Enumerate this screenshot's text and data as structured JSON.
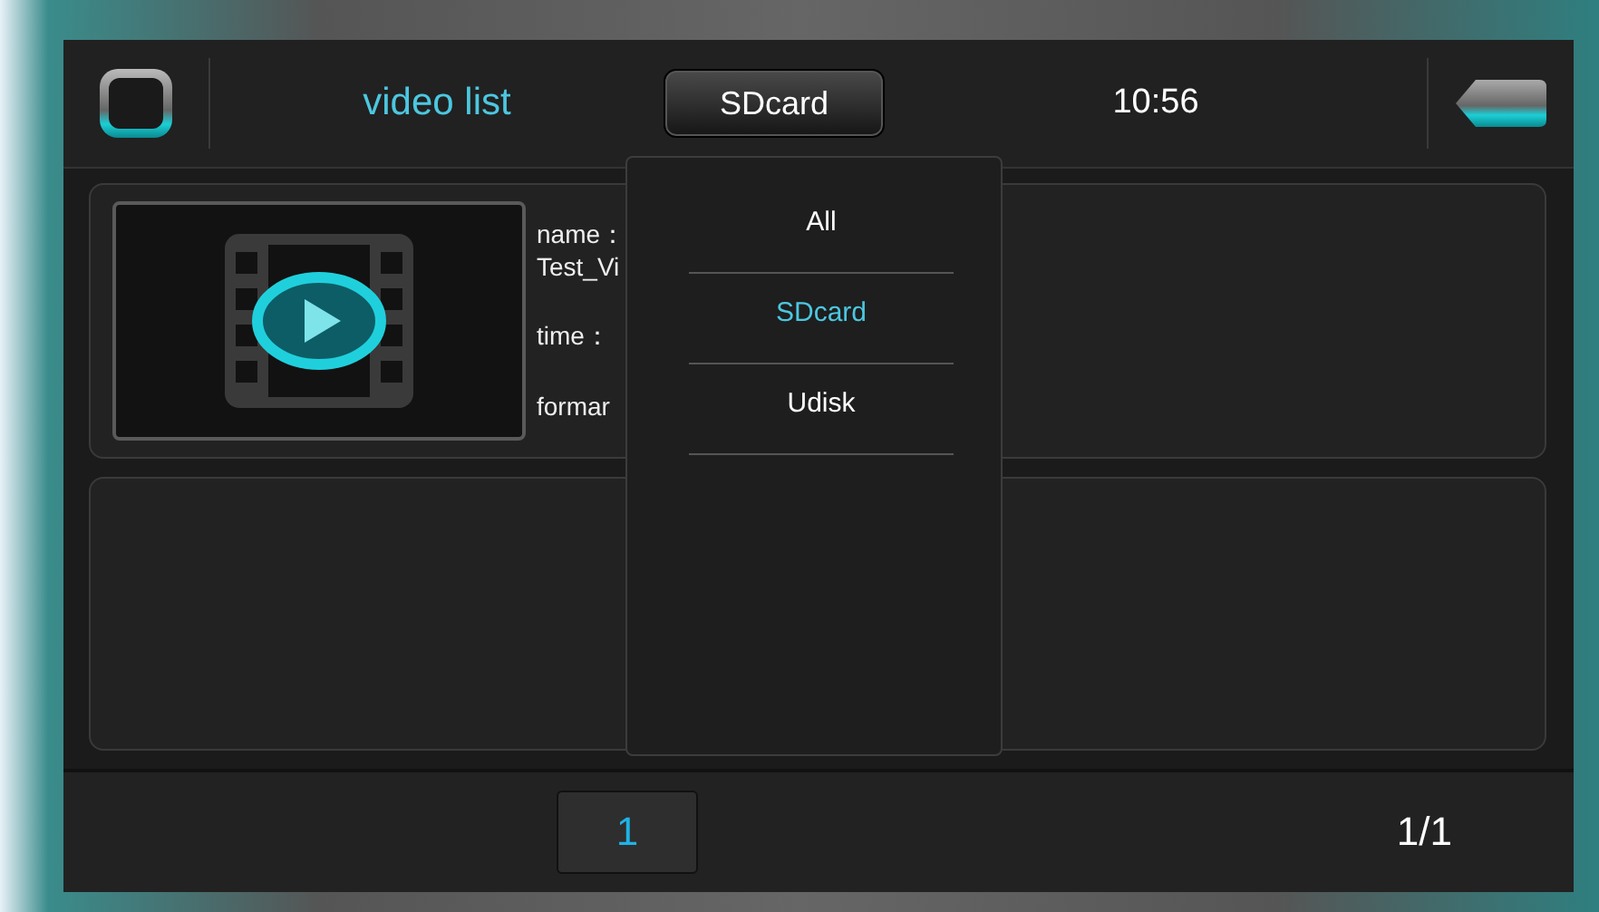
{
  "header": {
    "title": "video list",
    "source_button": "SDcard",
    "time": "10:56"
  },
  "slots": [
    {
      "kind": "video",
      "name_label": "name：",
      "name": "Test_Vi",
      "time_label": "time：",
      "format_label": "formar"
    },
    {
      "kind": "empty"
    }
  ],
  "dropdown": {
    "open": true,
    "items": [
      {
        "label": "All",
        "selected": false
      },
      {
        "label": "SDcard",
        "selected": true
      },
      {
        "label": "Udisk",
        "selected": false
      }
    ]
  },
  "footer": {
    "pages": [
      {
        "label": "1",
        "selected": true
      }
    ],
    "page_count": "1/1"
  }
}
